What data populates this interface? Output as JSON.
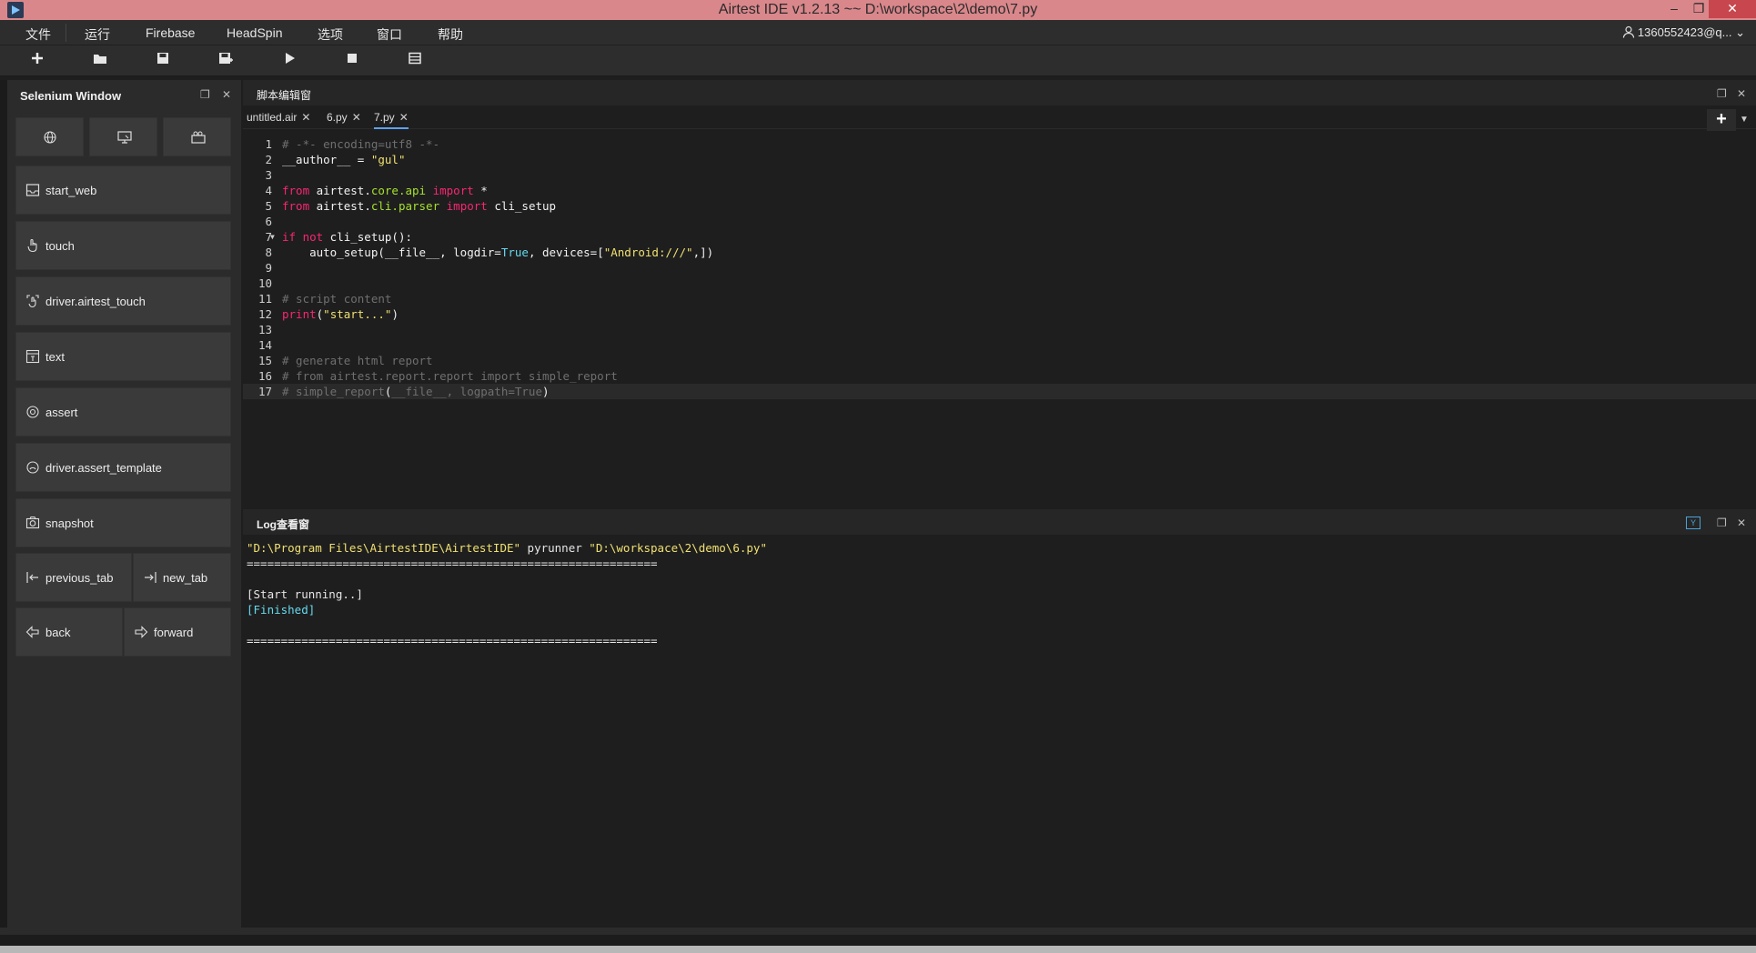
{
  "window": {
    "title": "Airtest IDE v1.2.13 ~~ D:\\workspace\\2\\demo\\7.py",
    "minimize": "–",
    "restore": "❐",
    "close": "✕"
  },
  "menubar": {
    "items": [
      "文件",
      "运行",
      "Firebase",
      "HeadSpin",
      "选项",
      "窗口",
      "帮助"
    ],
    "account": "1360552423@q..."
  },
  "toolbar": {
    "icons": [
      "new-file-icon",
      "open-folder-icon",
      "save-icon",
      "save-as-icon",
      "run-icon",
      "stop-icon",
      "log-icon"
    ]
  },
  "selenium": {
    "title": "Selenium Window",
    "top_icons": [
      "globe-icon",
      "screen-icon",
      "camera-icon"
    ],
    "buttons": [
      {
        "label": "start_web",
        "icon": "start-web-icon"
      },
      {
        "label": "touch",
        "icon": "touch-icon"
      },
      {
        "label": "driver.airtest_touch",
        "icon": "airtest-touch-icon"
      },
      {
        "label": "text",
        "icon": "text-icon"
      },
      {
        "label": "assert",
        "icon": "assert-icon"
      },
      {
        "label": "driver.assert_template",
        "icon": "assert-template-icon"
      },
      {
        "label": "snapshot",
        "icon": "snapshot-icon"
      }
    ],
    "pair_buttons": [
      {
        "label": "previous_tab",
        "icon": "previous-tab-icon"
      },
      {
        "label": "new_tab",
        "icon": "new-tab-icon"
      },
      {
        "label": "back",
        "icon": "back-arrow-icon"
      },
      {
        "label": "forward",
        "icon": "forward-arrow-icon"
      }
    ]
  },
  "editor": {
    "title": "脚本编辑窗",
    "tabs": [
      {
        "label": "untitled.air",
        "active": false
      },
      {
        "label": "6.py",
        "active": false
      },
      {
        "label": "7.py",
        "active": true
      }
    ],
    "add_tab": "+",
    "tab_close": "✕",
    "lines": [
      {
        "n": "1",
        "tokens": [
          {
            "c": "cm",
            "t": "# -*- encoding=utf8 -*-"
          }
        ]
      },
      {
        "n": "2",
        "tokens": [
          {
            "c": "nm",
            "t": "__author__ = "
          },
          {
            "c": "st",
            "t": "\"gul\""
          }
        ]
      },
      {
        "n": "3",
        "tokens": []
      },
      {
        "n": "4",
        "tokens": [
          {
            "c": "kw",
            "t": "from"
          },
          {
            "c": "nm",
            "t": " airtest."
          },
          {
            "c": "mod",
            "t": "core.api"
          },
          {
            "c": "nm",
            "t": " "
          },
          {
            "c": "kw",
            "t": "import"
          },
          {
            "c": "nm",
            "t": " *"
          }
        ]
      },
      {
        "n": "5",
        "tokens": [
          {
            "c": "kw",
            "t": "from"
          },
          {
            "c": "nm",
            "t": " airtest."
          },
          {
            "c": "mod",
            "t": "cli.parser"
          },
          {
            "c": "nm",
            "t": " "
          },
          {
            "c": "kw",
            "t": "import"
          },
          {
            "c": "nm",
            "t": " cli_setup"
          }
        ]
      },
      {
        "n": "6",
        "tokens": []
      },
      {
        "n": "7",
        "fold": true,
        "tokens": [
          {
            "c": "kw",
            "t": "if not"
          },
          {
            "c": "nm",
            "t": " cli_setup():"
          }
        ]
      },
      {
        "n": "8",
        "tokens": [
          {
            "c": "nm",
            "t": "    auto_setup(__file__, logdir="
          },
          {
            "c": "bi",
            "t": "True"
          },
          {
            "c": "nm",
            "t": ", devices=["
          },
          {
            "c": "st",
            "t": "\"Android:///\""
          },
          {
            "c": "nm",
            "t": ",])"
          }
        ]
      },
      {
        "n": "9",
        "tokens": []
      },
      {
        "n": "10",
        "tokens": []
      },
      {
        "n": "11",
        "tokens": [
          {
            "c": "cm",
            "t": "# script content"
          }
        ]
      },
      {
        "n": "12",
        "tokens": [
          {
            "c": "kw",
            "t": "print"
          },
          {
            "c": "nm",
            "t": "("
          },
          {
            "c": "st",
            "t": "\"start...\""
          },
          {
            "c": "nm",
            "t": ")"
          }
        ]
      },
      {
        "n": "13",
        "tokens": []
      },
      {
        "n": "14",
        "tokens": []
      },
      {
        "n": "15",
        "tokens": [
          {
            "c": "cm",
            "t": "# generate html report"
          }
        ]
      },
      {
        "n": "16",
        "tokens": [
          {
            "c": "cm",
            "t": "# from airtest.report.report import simple_report"
          }
        ]
      },
      {
        "n": "17",
        "current": true,
        "tokens": [
          {
            "c": "cm",
            "t": "# simple_report"
          },
          {
            "c": "nm",
            "t": "("
          },
          {
            "c": "cm",
            "t": "__file__, logpath=True"
          },
          {
            "c": "nm",
            "t": ")"
          }
        ]
      }
    ]
  },
  "log": {
    "title": "Log查看窗",
    "lines": [
      {
        "cls": "cmd",
        "parts": [
          {
            "c": "path",
            "t": "\"D:\\Program Files\\AirtestIDE\\AirtestIDE\""
          },
          {
            "c": "",
            "t": " pyrunner "
          },
          {
            "c": "path",
            "t": "\"D:\\workspace\\2\\demo\\6.py\""
          }
        ]
      },
      {
        "cls": "",
        "parts": [
          {
            "c": "",
            "t": "============================================================"
          }
        ]
      },
      {
        "cls": "",
        "parts": [
          {
            "c": "",
            "t": ""
          }
        ]
      },
      {
        "cls": "",
        "parts": [
          {
            "c": "",
            "t": "[Start running..]"
          }
        ]
      },
      {
        "cls": "fin",
        "parts": [
          {
            "c": "",
            "t": "[Finished]"
          }
        ]
      },
      {
        "cls": "",
        "parts": [
          {
            "c": "",
            "t": ""
          }
        ]
      },
      {
        "cls": "",
        "parts": [
          {
            "c": "",
            "t": "============================================================"
          }
        ]
      }
    ]
  },
  "colors": {
    "titlebar": "#d9878b",
    "accent": "#5ea1f0",
    "keyword": "#f92672",
    "string": "#f0e070",
    "comment": "#6f6f6f"
  }
}
